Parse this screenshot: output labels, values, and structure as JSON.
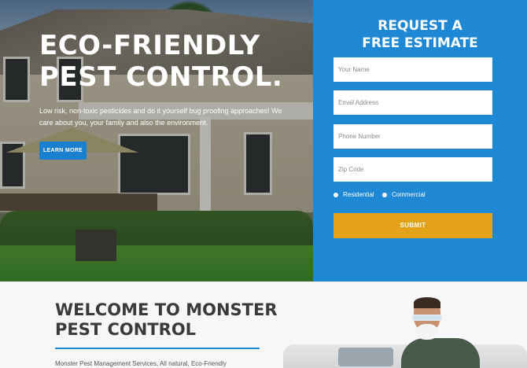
{
  "hero": {
    "title_line1": "ECO-FRIENDLY",
    "title_line2": "PEST CONTROL.",
    "subtitle": "Low risk, non-toxic pesticides and do it yourself bug proofing approaches! We care about you, your family and also the environment.",
    "cta_label": "LEARN MORE"
  },
  "form": {
    "title_line1": "REQUEST A",
    "title_line2": "FREE ESTIMATE",
    "fields": [
      {
        "placeholder": "Your Name",
        "value": ""
      },
      {
        "placeholder": "Email Address",
        "value": ""
      },
      {
        "placeholder": "Phone Number",
        "value": ""
      },
      {
        "placeholder": "Zip Code",
        "value": ""
      }
    ],
    "radio_options": [
      "Residential",
      "Commercial"
    ],
    "submit_label": "SUBMIT"
  },
  "welcome": {
    "title_line1": "WELCOME TO MONSTER",
    "title_line2": "PEST CONTROL",
    "text": "Monster Pest Management Services, All natural, Eco-Friendly"
  },
  "colors": {
    "form_bg": "#1e88d4",
    "submit_bg": "#e3a21a",
    "cta_bg": "#1b7fd0",
    "accent_rule": "#1e88d4"
  }
}
